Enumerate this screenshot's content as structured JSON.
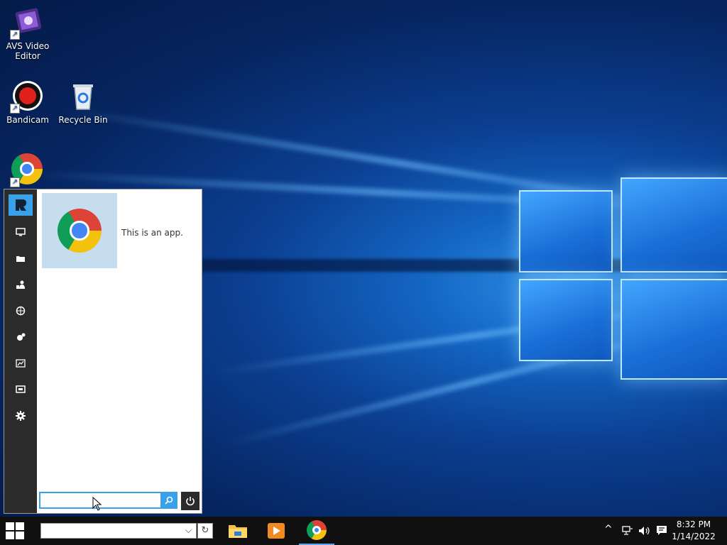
{
  "desktop_icons": [
    {
      "label": "AVS Video Editor",
      "icon": "film-reel-icon"
    },
    {
      "label": "Bandicam",
      "icon": "record-icon"
    },
    {
      "label": "Recycle Bin",
      "icon": "recycle-bin-icon"
    },
    {
      "label": "",
      "icon": "chrome-icon"
    }
  ],
  "start_menu": {
    "rail_icons": [
      "logo-icon",
      "monitor-icon",
      "folder-icon",
      "users-icon",
      "network-icon",
      "services-icon",
      "performance-icon",
      "display-icon",
      "gear-icon"
    ],
    "tile": {
      "icon": "chrome-icon",
      "text": "This is an app."
    },
    "search": {
      "value": "",
      "placeholder": ""
    }
  },
  "taskbar": {
    "search": {
      "value": ""
    },
    "pinned": [
      {
        "name": "file-explorer",
        "icon": "folder-icon",
        "active": false
      },
      {
        "name": "media-player",
        "icon": "play-icon",
        "active": false
      },
      {
        "name": "chrome",
        "icon": "chrome-icon",
        "active": true
      }
    ],
    "clock": {
      "time": "8:32 PM",
      "date": "1/14/2022"
    }
  },
  "colors": {
    "accent": "#39a1ea",
    "rail": "#2b2b2b",
    "taskbar": "#101010",
    "tile": "#c6ddf0"
  }
}
